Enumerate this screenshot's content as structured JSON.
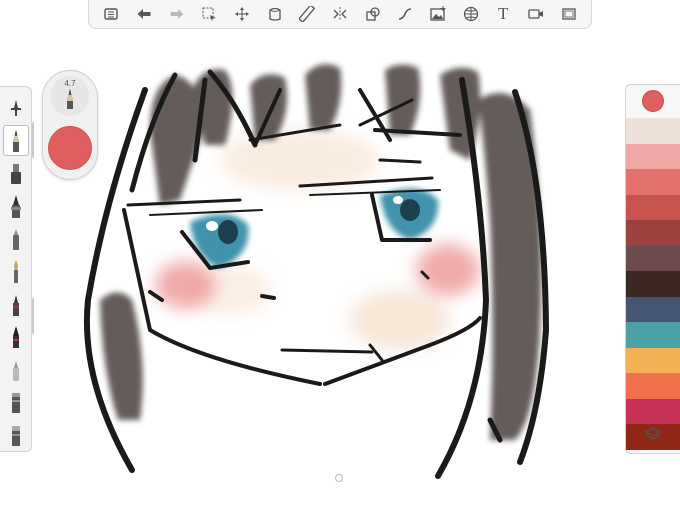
{
  "toolbar": {
    "tools": [
      {
        "name": "gallery-icon"
      },
      {
        "name": "undo-icon"
      },
      {
        "name": "redo-icon"
      },
      {
        "name": "selection-icon"
      },
      {
        "name": "transform-icon"
      },
      {
        "name": "fill-icon"
      },
      {
        "name": "ruler-icon"
      },
      {
        "name": "symmetry-icon"
      },
      {
        "name": "shapes-icon"
      },
      {
        "name": "curve-icon"
      },
      {
        "name": "import-image-icon"
      },
      {
        "name": "perspective-icon"
      },
      {
        "name": "text-icon",
        "label": "T"
      },
      {
        "name": "video-icon"
      },
      {
        "name": "fullscreen-icon"
      }
    ]
  },
  "brush_puck": {
    "size_value": "4.7",
    "color": "#df5f5f"
  },
  "brushes": {
    "selected_index": 1,
    "items": [
      "flat-brush-icon",
      "pencil-icon",
      "marker-icon",
      "ink-pen-icon",
      "wide-marker-icon",
      "paintbrush-icon",
      "airbrush-icon",
      "fineliner-icon",
      "chalk-icon",
      "eraser-icon",
      "blender-icon"
    ]
  },
  "colors": {
    "current": "#df5f5f",
    "swatches": [
      "#ede1d9",
      "#f1a8a6",
      "#e3706d",
      "#c85450",
      "#9b4240",
      "#6c4a4d",
      "#3b2722",
      "#475575",
      "#4aa1a6",
      "#f4b153",
      "#f0704b",
      "#c63155",
      "#8f2616"
    ]
  },
  "canvas": {
    "background": "#ffffff",
    "ink_color": "#1a1a1a",
    "hair_color": "#4a403c",
    "blush_color": "#ec8f90",
    "eye_color": "#3f93ab"
  }
}
